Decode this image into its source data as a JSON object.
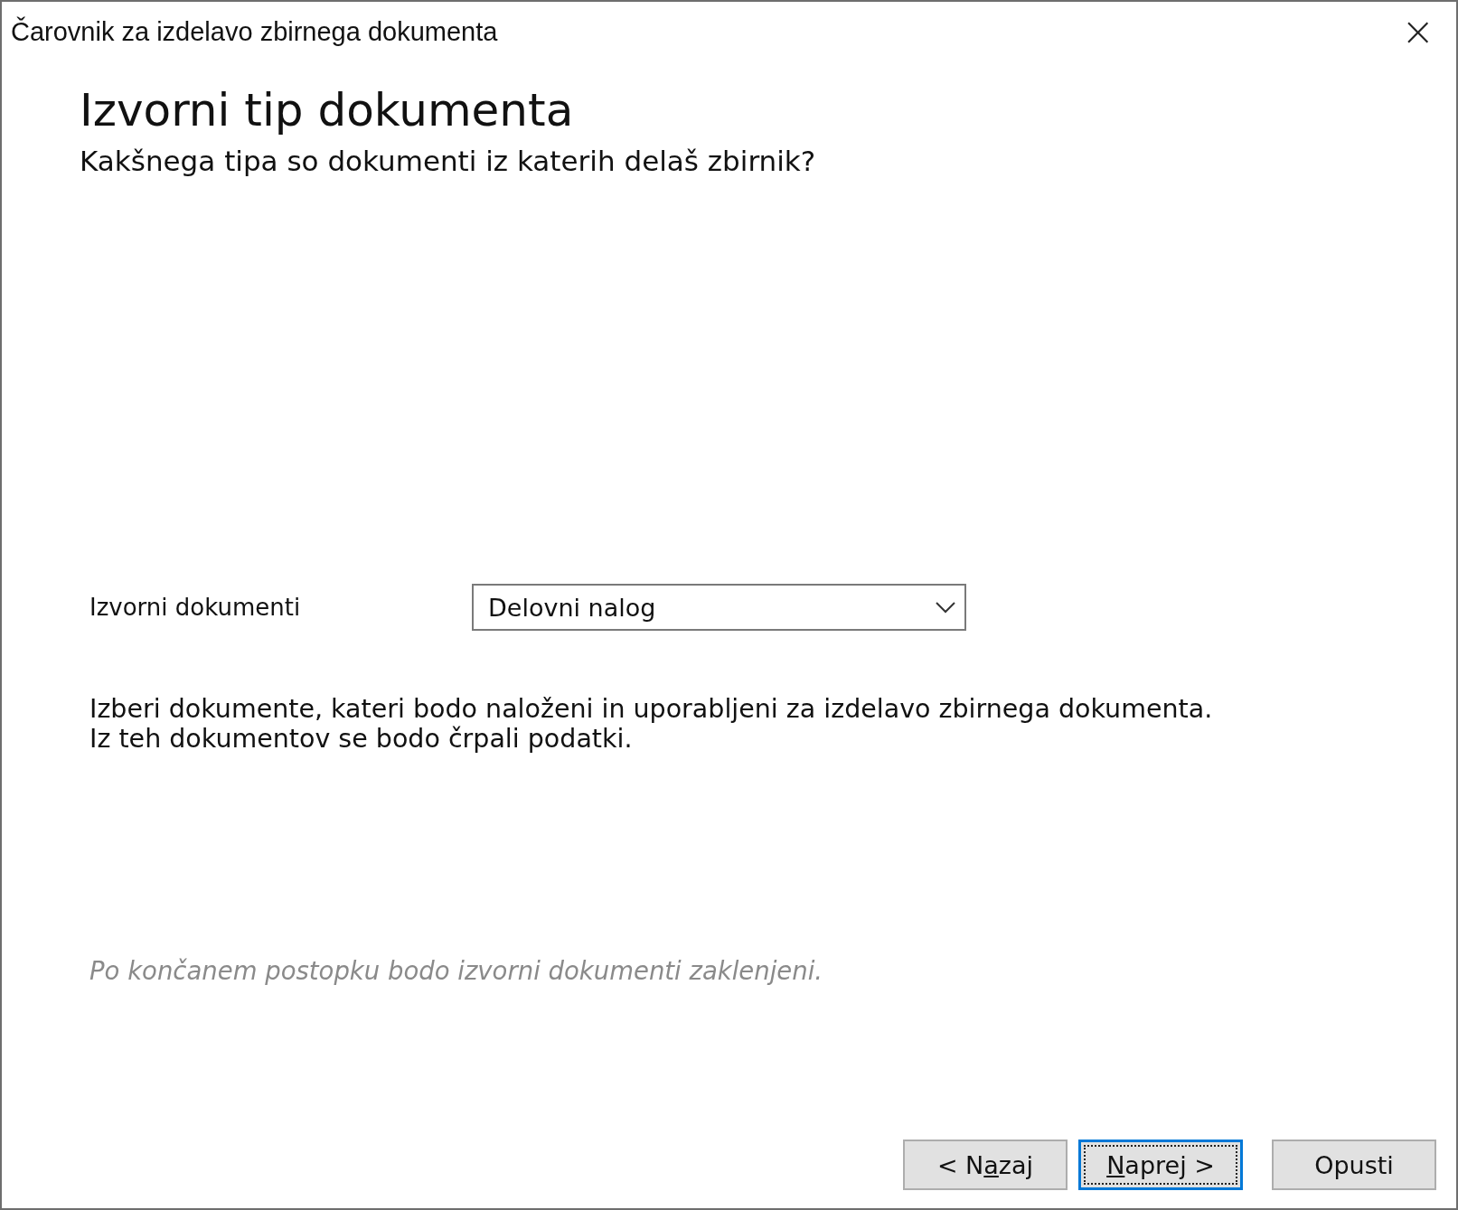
{
  "window": {
    "title": "Čarovnik za izdelavo zbirnega dokumenta",
    "close": "×"
  },
  "header": {
    "title": "Izvorni tip dokumenta",
    "subtitle": "Kakšnega tipa so dokumenti iz katerih delaš zbirnik?"
  },
  "source_field": {
    "label": "Izvorni dokumenti",
    "value": "Delovni nalog"
  },
  "description": [
    "Izberi dokumente, kateri bodo naloženi in uporabljeni za izdelavo zbirnega dokumenta.",
    "Iz teh dokumentov se bodo črpali podatki."
  ],
  "note": "Po končanem postopku bodo izvorni dokumenti zaklenjeni.",
  "buttons": [
    {
      "label_before": "< N",
      "access_key": "a",
      "label_after": "zaj",
      "focused": false
    },
    {
      "access_key": "N",
      "label_after": "aprej >",
      "focused": true
    },
    {
      "label_before": "Opusti",
      "focused": false
    }
  ]
}
